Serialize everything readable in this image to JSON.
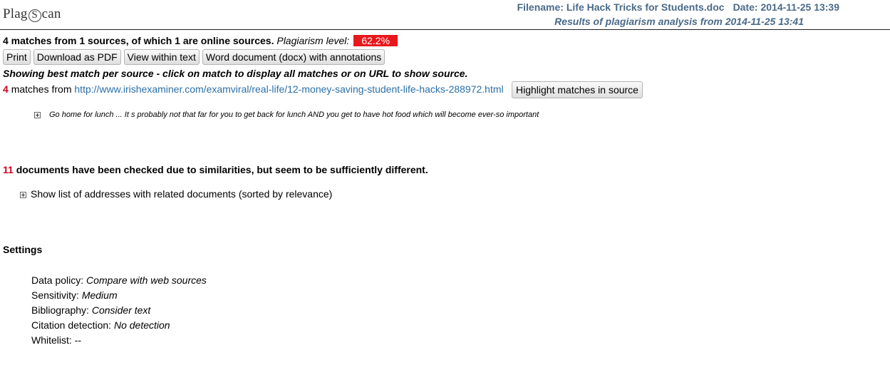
{
  "header": {
    "logo": {
      "pre": "Plag",
      "mid": "S",
      "post": "can"
    },
    "filename_label": "Filename: Life Hack Tricks for Students.doc",
    "date_label": "Date: 2014-11-25 13:39",
    "results_label": "Results of plagiarism analysis from 2014-11-25 13:41"
  },
  "summary": {
    "text": "4 matches from 1 sources, of which 1 are online sources.",
    "level_label": "Plagiarism level:",
    "level_value": "62.2%"
  },
  "colors": {
    "accent_red": "#e8171c",
    "header_text": "#4a6a8a",
    "link": "#2a6fa8"
  },
  "toolbar": {
    "print": "Print",
    "pdf": "Download as PDF",
    "view_text": "View within text",
    "word_doc": "Word document (docx) with annotations"
  },
  "showing_text": "Showing best match per source - click on match to display all matches or on URL to show source.",
  "match_source": {
    "count": "4",
    "matches_from": "matches from",
    "url": "http://www.irishexaminer.com/examviral/real-life/12-money-saving-student-life-hacks-288972.html",
    "highlight_button": "Highlight matches in source"
  },
  "snippet": {
    "icon": "expand-plus-icon",
    "text": "Go home for lunch ... It s probably not that far for you to get back for lunch AND you get to have hot food which will become ever-so important"
  },
  "checked": {
    "count": "11",
    "text": "documents have been checked due to similarities, but seem to be sufficiently different."
  },
  "related": {
    "icon": "expand-plus-icon",
    "text": "Show list of addresses with related documents (sorted by relevance)"
  },
  "settings": {
    "title": "Settings",
    "items": [
      {
        "label": "Data policy:",
        "value": "Compare with web sources"
      },
      {
        "label": "Sensitivity:",
        "value": "Medium"
      },
      {
        "label": "Bibliography:",
        "value": "Consider text"
      },
      {
        "label": "Citation detection:",
        "value": "No detection"
      },
      {
        "label": "Whitelist:",
        "value": "--"
      }
    ]
  }
}
